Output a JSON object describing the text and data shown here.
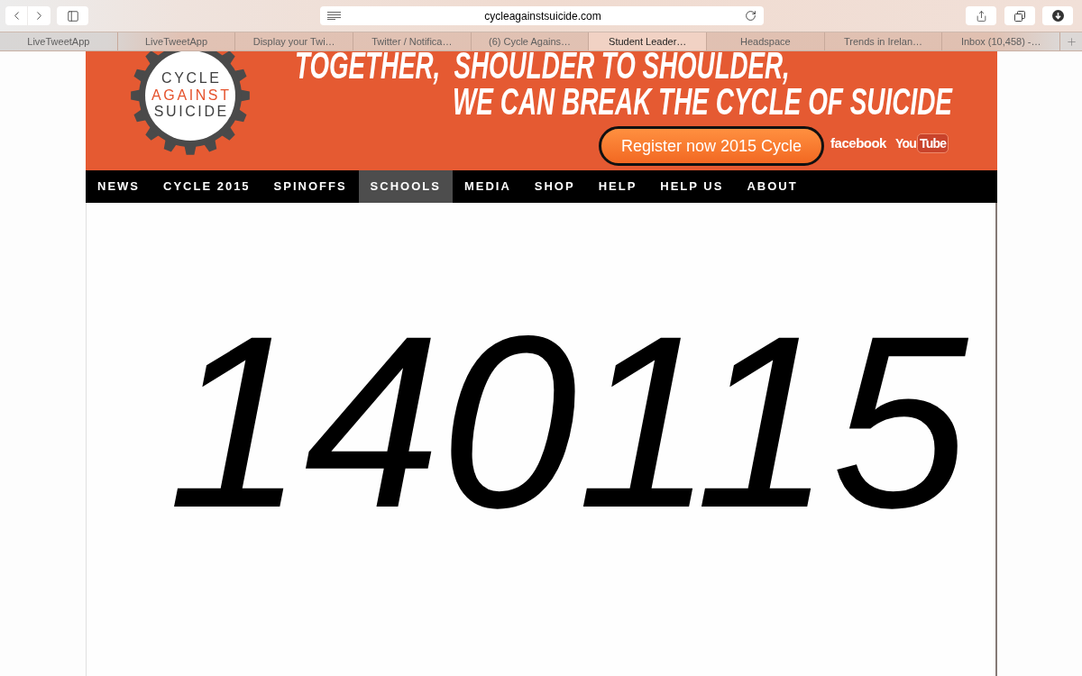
{
  "browser": {
    "address": "cycleagainstsuicide.com",
    "tabs": [
      {
        "label": "LiveTweetApp",
        "selected": false
      },
      {
        "label": "LiveTweetApp",
        "selected": false
      },
      {
        "label": "Display your Twi…",
        "selected": false
      },
      {
        "label": "Twitter / Notifica…",
        "selected": false
      },
      {
        "label": "(6) Cycle Agains…",
        "selected": false
      },
      {
        "label": "Student Leader…",
        "selected": true
      },
      {
        "label": "Headspace",
        "selected": false
      },
      {
        "label": "Trends in Irelan…",
        "selected": false
      },
      {
        "label": "Inbox (10,458) -…",
        "selected": false
      }
    ]
  },
  "header": {
    "logo": {
      "lines": [
        {
          "text": "CYCLE",
          "color": "#3f3f3f"
        },
        {
          "text": "AGAINST",
          "color": "#e5522c"
        },
        {
          "text": "SUICIDE",
          "color": "#3f3f3f"
        }
      ]
    },
    "headline": [
      "TOGETHER,  SHOULDER TO SHOULDER,",
      "WE CAN BREAK THE CYCLE OF SUICIDE"
    ],
    "register_button": "Register now 2015 Cycle",
    "facebook": "facebook",
    "youtube": {
      "you": "You",
      "tube": "Tube"
    }
  },
  "nav": [
    {
      "label": "NEWS",
      "selected": false
    },
    {
      "label": "CYCLE 2015",
      "selected": false
    },
    {
      "label": "SPINOFFS",
      "selected": false
    },
    {
      "label": "SCHOOLS",
      "selected": true
    },
    {
      "label": "MEDIA",
      "selected": false
    },
    {
      "label": "SHOP",
      "selected": false
    },
    {
      "label": "HELP",
      "selected": false
    },
    {
      "label": "HELP US",
      "selected": false
    },
    {
      "label": "ABOUT",
      "selected": false
    }
  ],
  "content": {
    "number": "140115"
  }
}
